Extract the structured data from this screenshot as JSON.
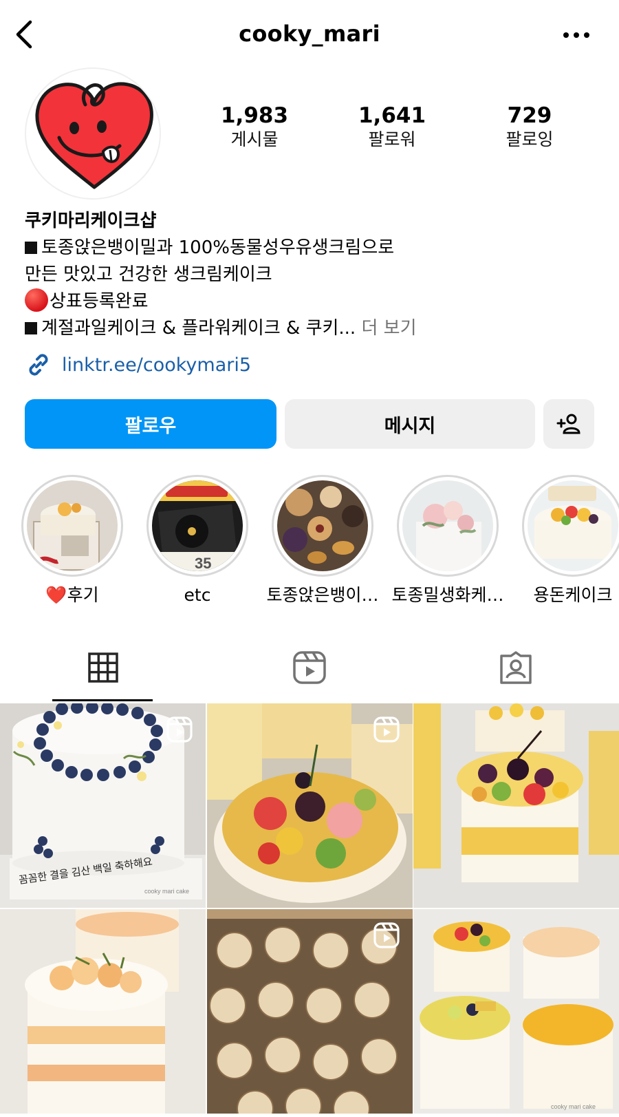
{
  "header": {
    "username": "cooky_mari",
    "back_icon": "chevron-left-icon",
    "more_icon": "more-horizontal-icon"
  },
  "profile": {
    "stats": [
      {
        "value": "1,983",
        "label": "게시물"
      },
      {
        "value": "1,641",
        "label": "팔로워"
      },
      {
        "value": "729",
        "label": "팔로잉"
      }
    ],
    "display_name": "쿠키마리케이크샵",
    "bio_lines": [
      "토종앉은뱅이밀과 100%동물성우유생크림으로",
      "만든 맛있고 건강한 생크림케이크",
      "상표등록완료",
      "계절과일케이크 & 플라워케이크 & 쿠키..."
    ],
    "more_label": "더 보기",
    "link": "linktr.ee/cookymari5"
  },
  "actions": {
    "follow_label": "팔로우",
    "message_label": "메시지",
    "add_user_icon": "add-person-icon",
    "follow_color": "#0095f6"
  },
  "highlights": [
    {
      "label": "후기",
      "emoji": "❤️"
    },
    {
      "label": "etc"
    },
    {
      "label": "토종앉은뱅이…"
    },
    {
      "label": "토종밀생화케…"
    },
    {
      "label": "용돈케이크"
    }
  ],
  "tabs": [
    {
      "name": "grid",
      "icon": "grid-icon",
      "active": true
    },
    {
      "name": "reels",
      "icon": "reels-icon",
      "active": false
    },
    {
      "name": "tagged",
      "icon": "tagged-person-icon",
      "active": false
    }
  ],
  "posts": [
    {
      "reel": true,
      "caption_text": "꼼꼼한 결을 김산 백일 축하해요",
      "watermark": "cooky mari cake"
    },
    {
      "reel": true
    },
    {
      "reel": false
    },
    {
      "reel": false
    },
    {
      "reel": true
    },
    {
      "reel": false,
      "watermark": "cooky mari cake"
    }
  ]
}
